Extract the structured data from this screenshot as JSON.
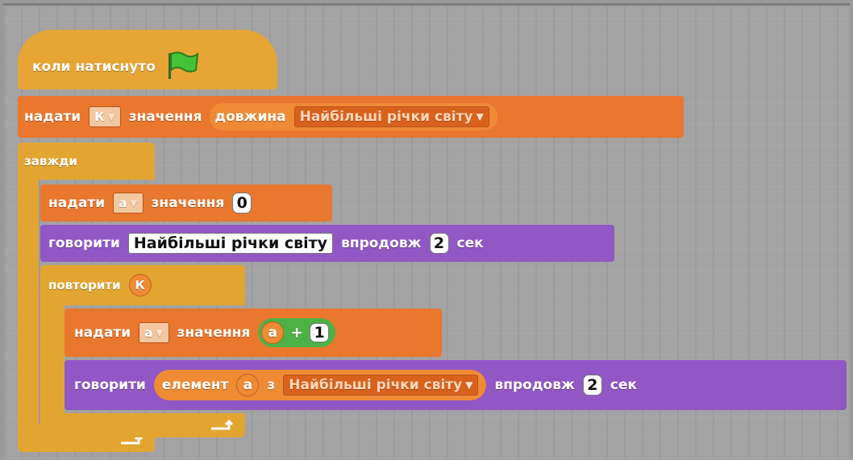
{
  "hat": {
    "label": "коли натиснуто",
    "icon": "green-flag-icon"
  },
  "set_k": {
    "keyword": "надати",
    "variable": "К",
    "label": "значення",
    "reporter": "довжина",
    "list": "Найбільші річки світу"
  },
  "forever": {
    "label": "завжди"
  },
  "set_a": {
    "keyword": "надати",
    "variable": "а",
    "label": "значення",
    "value": "0"
  },
  "say_title": {
    "keyword": "говорити",
    "message": "Найбільші річки світу",
    "for_label": "впродовж",
    "seconds": "2",
    "unit": "сек"
  },
  "repeat": {
    "label": "повторити",
    "count_var": "К"
  },
  "inc_a": {
    "keyword": "надати",
    "variable": "а",
    "label": "значення",
    "left": "а",
    "operator": "+",
    "right": "1"
  },
  "say_item": {
    "keyword": "говорити",
    "reporter": "елемент",
    "index_var": "а",
    "of": "з",
    "list": "Найбільші річки світу",
    "for_label": "впродовж",
    "seconds": "2",
    "unit": "сек"
  },
  "colors": {
    "events": "#e6a534",
    "control": "#e3a532",
    "data": "#e9772e",
    "looks": "#9157c5",
    "operators": "#4db245"
  }
}
